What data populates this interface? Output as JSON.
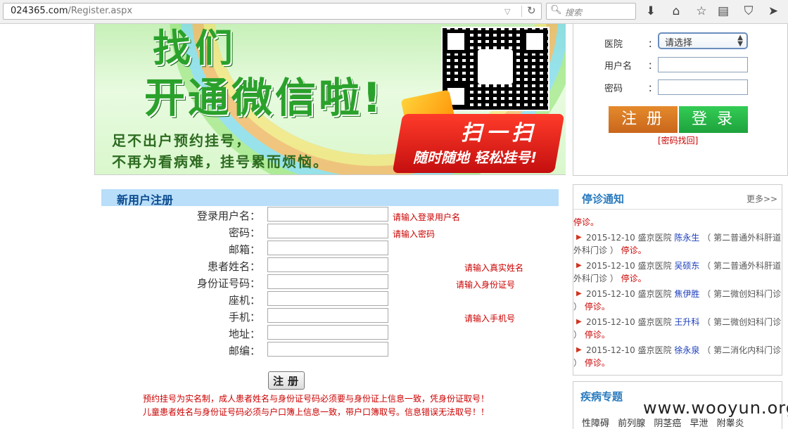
{
  "browser": {
    "url_domain": "024365.com",
    "url_path": "/Register.aspx",
    "search_placeholder": "搜索"
  },
  "banner": {
    "title_line1": "找们",
    "title_line2": "开通微信啦!",
    "slogan_line1": "足不出户预约挂号，",
    "slogan_line2": "不再为看病难，挂号累而烦恼。",
    "scan_title": "扫一扫",
    "scan_sub": "随时随地 轻松挂号!"
  },
  "login": {
    "hospital_label": "医院",
    "username_label": "用户名",
    "password_label": "密码",
    "colon": "：",
    "hospital_select": "请选择",
    "register_button": "注册",
    "login_button": "登录",
    "forgot_link": "[密码找回]"
  },
  "register": {
    "title": "新用户注册",
    "fields": [
      {
        "label": "登录用户名：",
        "hint": "请输入登录用户名"
      },
      {
        "label": "密码：",
        "hint": "请输入密码"
      },
      {
        "label": "邮箱：",
        "hint": ""
      },
      {
        "label": "患者姓名：",
        "hint": "请输入真实姓名"
      },
      {
        "label": "身份证号码：",
        "hint": "请输入身份证号"
      },
      {
        "label": "座机：",
        "hint": ""
      },
      {
        "label": "手机：",
        "hint": "请输入手机号"
      },
      {
        "label": "地址：",
        "hint": ""
      },
      {
        "label": "邮编：",
        "hint": ""
      }
    ],
    "submit_button": "注册",
    "note_line1": "预约挂号为实名制，成人患者姓名与身份证号码必须要与身份证上信息一致，凭身份证取号！",
    "note_line2": "儿童患者姓名与身份证号码必须与户口簿上信息一致，带户口簿取号。信息错误无法取号！！"
  },
  "notices": {
    "title": "停诊通知",
    "more": "更多>>",
    "stop_text": "停诊。",
    "items": [
      {
        "date": "2015-12-10",
        "hospital": "盛京医院",
        "doctor": "陈永生",
        "dept": "（ 第二普通外科肝道",
        "dept2": "外科门诊 ）"
      },
      {
        "date": "2015-12-10",
        "hospital": "盛京医院",
        "doctor": "吴硕东",
        "dept": "（ 第二普通外科肝道",
        "dept2": "外科门诊 ）"
      },
      {
        "date": "2015-12-10",
        "hospital": "盛京医院",
        "doctor": "焦伊胜",
        "dept": "（ 第二微创妇科门诊",
        "dept2": "）"
      },
      {
        "date": "2015-12-10",
        "hospital": "盛京医院",
        "doctor": "王升科",
        "dept": "（ 第二微创妇科门诊",
        "dept2": "）"
      },
      {
        "date": "2015-12-10",
        "hospital": "盛京医院",
        "doctor": "徐永泉",
        "dept": "（ 第二消化内科门诊",
        "dept2": "）"
      }
    ]
  },
  "disease": {
    "title": "疾病专题",
    "items": [
      "性障碍",
      "前列腺",
      "阴茎癌",
      "早泄",
      "附睾炎"
    ]
  },
  "watermark": "www.wooyun.org"
}
